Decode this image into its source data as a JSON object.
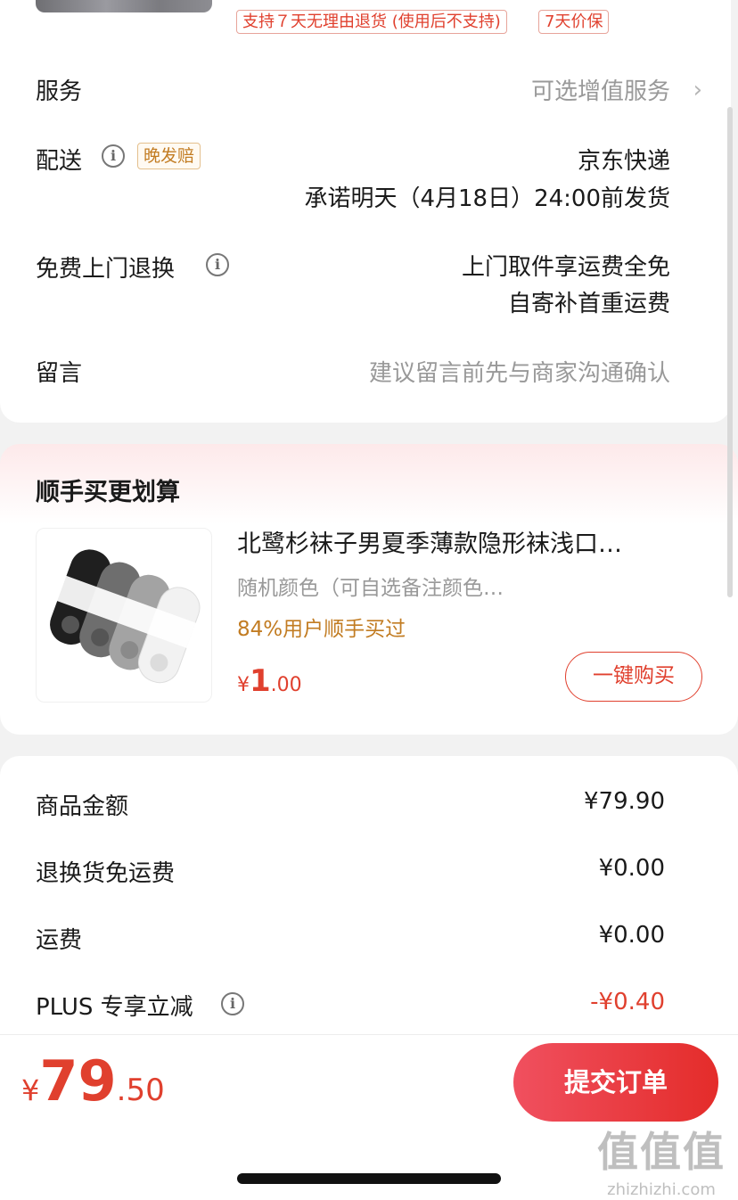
{
  "top": {
    "tags": [
      "支持７天无理由退货 (使用后不支持)",
      "7天价保"
    ],
    "service": {
      "label": "服务",
      "value": "可选增值服务",
      "chevron": "›"
    },
    "delivery": {
      "label": "配送",
      "badge": "晚发赔",
      "carrier": "京东快递",
      "promise": "承诺明天（4月18日）24:00前发货"
    },
    "free_return": {
      "label": "免费上门退换",
      "line1": "上门取件享运费全免",
      "line2": "自寄补首重运费"
    },
    "message": {
      "label": "留言",
      "placeholder": "建议留言前先与商家沟通确认"
    }
  },
  "addon": {
    "title": "顺手买更划算",
    "product_name": "北鹭杉袜子男夏季薄款隐形袜浅口…",
    "spec": "随机颜色（可自选备注颜色…",
    "percent_text": "84%用户顺手买过",
    "price_symbol": "¥",
    "price_int": "1",
    "price_dec": ".00",
    "buy_label": "一键购买"
  },
  "fees": {
    "items": [
      {
        "label": "商品金额",
        "value": "¥79.90"
      },
      {
        "label": "退换货免运费",
        "value": "¥0.00"
      },
      {
        "label": "运费",
        "value": "¥0.00"
      },
      {
        "label": "PLUS 专享立减",
        "value": "-¥0.40"
      }
    ]
  },
  "bottom": {
    "total_symbol": "¥",
    "total_int": "79",
    "total_dec": ".50",
    "submit_label": "提交订单"
  },
  "watermark": {
    "big": "值值值",
    "small": "zhizhizhi.com"
  },
  "colors": {
    "accent": "#e0402e",
    "gold": "#c27c22"
  },
  "icons": [
    "info-icon",
    "chevron-right-icon"
  ]
}
